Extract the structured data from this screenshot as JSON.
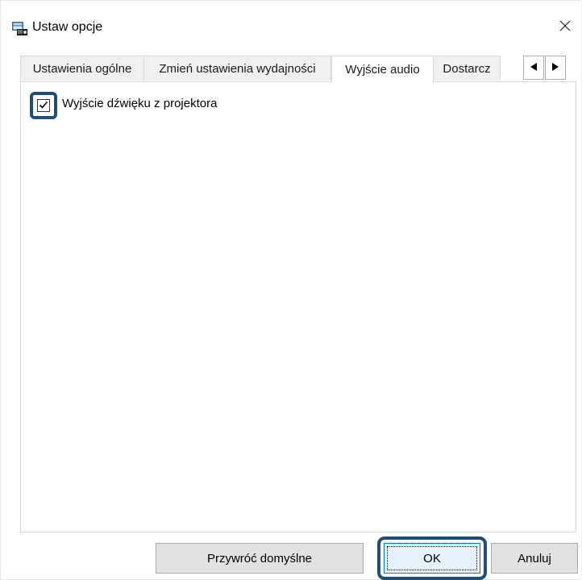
{
  "window": {
    "title": "Ustaw opcje",
    "app_icon": "projector-app-icon",
    "close_icon": "close-icon"
  },
  "tabs": [
    {
      "label": "Ustawienia ogólne",
      "active": false
    },
    {
      "label": "Zmień ustawienia wydajności",
      "active": false
    },
    {
      "label": "Wyjście audio",
      "active": true
    },
    {
      "label": "Dostarcz",
      "active": false
    }
  ],
  "tab_scroll": {
    "left_icon": "triangle-left-icon",
    "right_icon": "triangle-right-icon"
  },
  "audio_panel": {
    "projector_audio_checkbox": {
      "label": "Wyjście dźwięku z projektora",
      "checked": true
    }
  },
  "buttons": {
    "restore_defaults": "Przywróć domyślne",
    "ok": "OK",
    "cancel": "Anuluj"
  },
  "colors": {
    "highlight_border": "#1f4e79",
    "ok_button_bg": "#e5f1fb",
    "ok_button_border": "#0078d7",
    "button_bg": "#e1e1e1"
  }
}
